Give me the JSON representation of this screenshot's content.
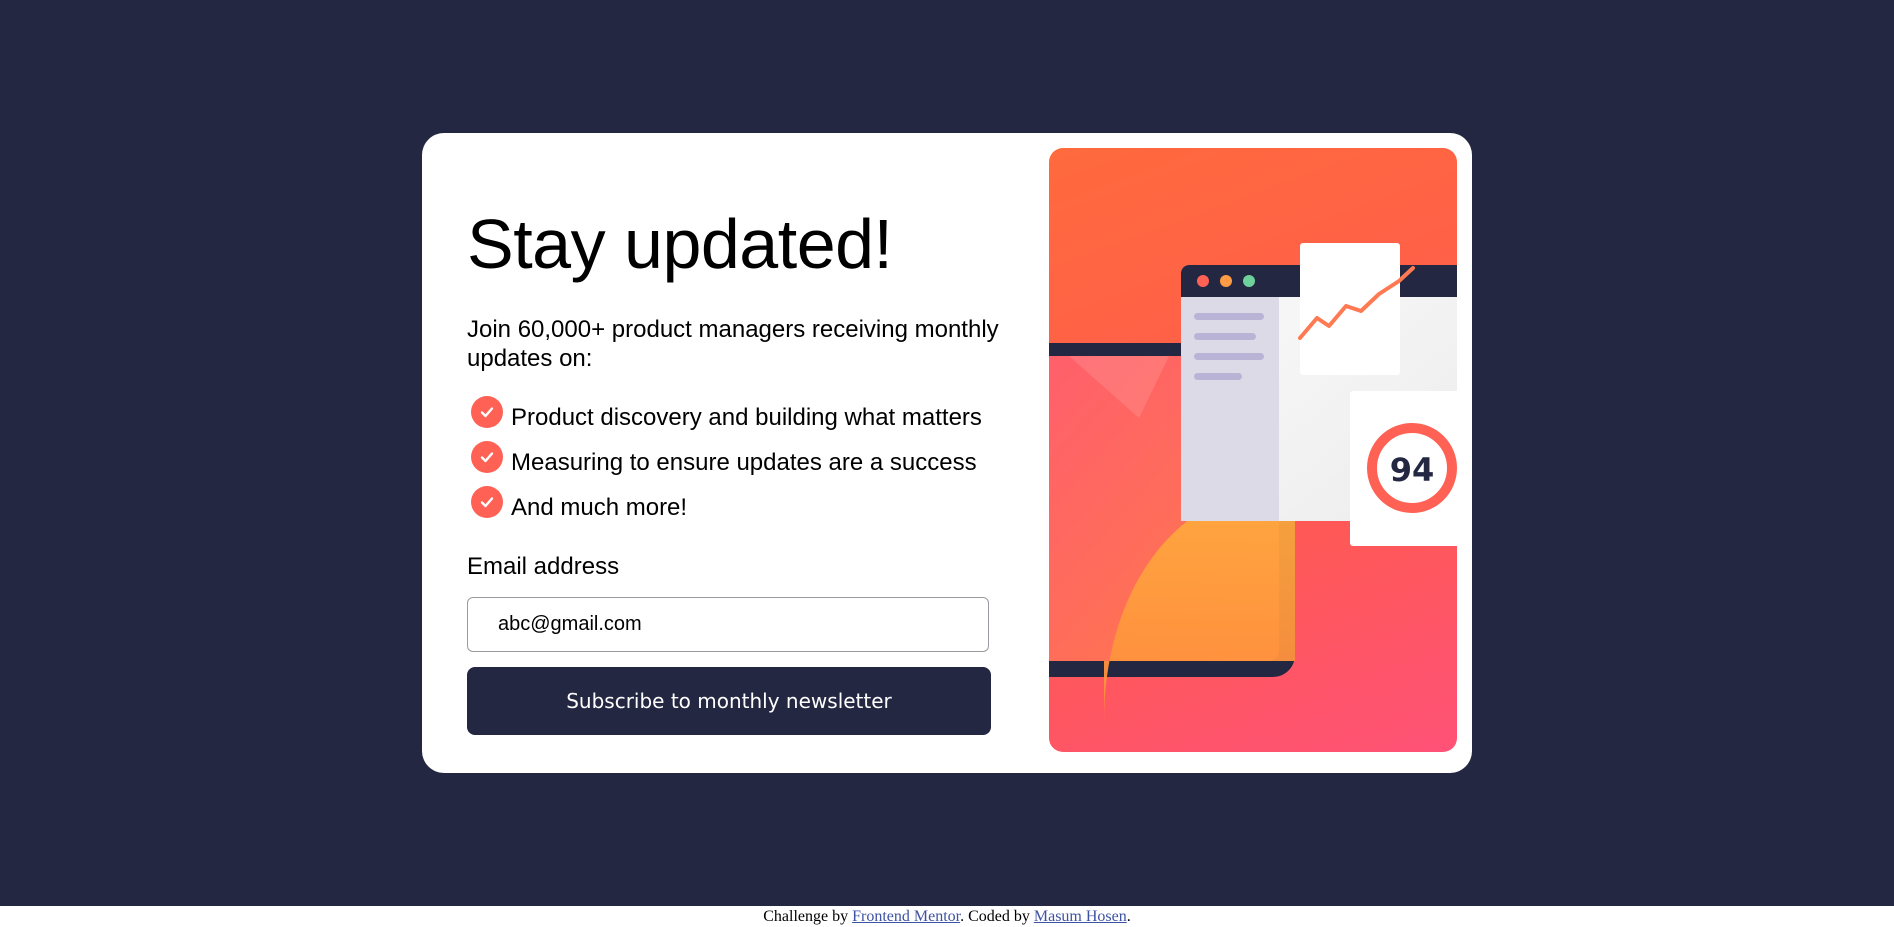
{
  "card": {
    "title": "Stay updated!",
    "intro": "Join 60,000+ product managers receiving monthly updates on:",
    "features": [
      "Product discovery and building what matters",
      "Measuring to ensure updates are a success",
      "And much more!"
    ],
    "email_label": "Email address",
    "email_value": "abc@gmail.com",
    "subscribe_label": "Subscribe to monthly newsletter"
  },
  "illustration": {
    "score": "94"
  },
  "footer": {
    "prefix": "Challenge by ",
    "link1": "Frontend Mentor",
    "middle": ". Coded by ",
    "link2": "Masum Hosen",
    "suffix": "."
  },
  "colors": {
    "background": "#242742",
    "accent": "#ff6155",
    "button": "#242742"
  }
}
